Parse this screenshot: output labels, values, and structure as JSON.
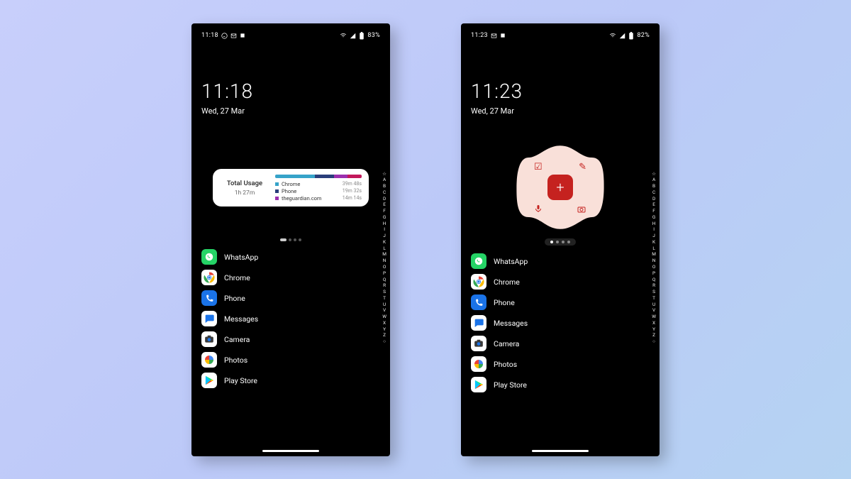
{
  "alphabet": [
    "☆",
    "A",
    "B",
    "C",
    "D",
    "E",
    "F",
    "G",
    "H",
    "I",
    "J",
    "K",
    "L",
    "M",
    "N",
    "O",
    "P",
    "Q",
    "R",
    "S",
    "T",
    "U",
    "V",
    "W",
    "X",
    "Y",
    "Z",
    "○"
  ],
  "phones": [
    {
      "status": {
        "time": "11:18",
        "battery": "83%"
      },
      "clock": {
        "time": "11:18",
        "date": "Wed, 27 Mar"
      },
      "widget": "usage",
      "usage": {
        "title": "Total Usage",
        "total": "1h 27m",
        "segments": [
          {
            "color": "#36a3c9",
            "pct": 46
          },
          {
            "color": "#2a3e7a",
            "pct": 22
          },
          {
            "color": "#9b2fae",
            "pct": 16
          },
          {
            "color": "#c2185b",
            "pct": 16
          }
        ],
        "rows": [
          {
            "color": "#36a3c9",
            "name": "Chrome",
            "time": "39m 48s"
          },
          {
            "color": "#2a3e7a",
            "name": "Phone",
            "time": "19m 32s"
          },
          {
            "color": "#9b2fae",
            "name": "theguardian.com",
            "time": "14m 14s"
          }
        ]
      },
      "apps": [
        {
          "icon": "whatsapp",
          "label": "WhatsApp"
        },
        {
          "icon": "chrome",
          "label": "Chrome"
        },
        {
          "icon": "phone",
          "label": "Phone"
        },
        {
          "icon": "messages",
          "label": "Messages"
        },
        {
          "icon": "camera",
          "label": "Camera"
        },
        {
          "icon": "photos",
          "label": "Photos"
        },
        {
          "icon": "play",
          "label": "Play Store"
        }
      ]
    },
    {
      "status": {
        "time": "11:23",
        "battery": "82%"
      },
      "clock": {
        "time": "11:23",
        "date": "Wed, 27 Mar"
      },
      "widget": "keep",
      "apps": [
        {
          "icon": "whatsapp",
          "label": "WhatsApp"
        },
        {
          "icon": "chrome",
          "label": "Chrome"
        },
        {
          "icon": "phone",
          "label": "Phone"
        },
        {
          "icon": "messages",
          "label": "Messages"
        },
        {
          "icon": "camera",
          "label": "Camera"
        },
        {
          "icon": "photos",
          "label": "Photos"
        },
        {
          "icon": "play",
          "label": "Play Store"
        }
      ]
    }
  ]
}
